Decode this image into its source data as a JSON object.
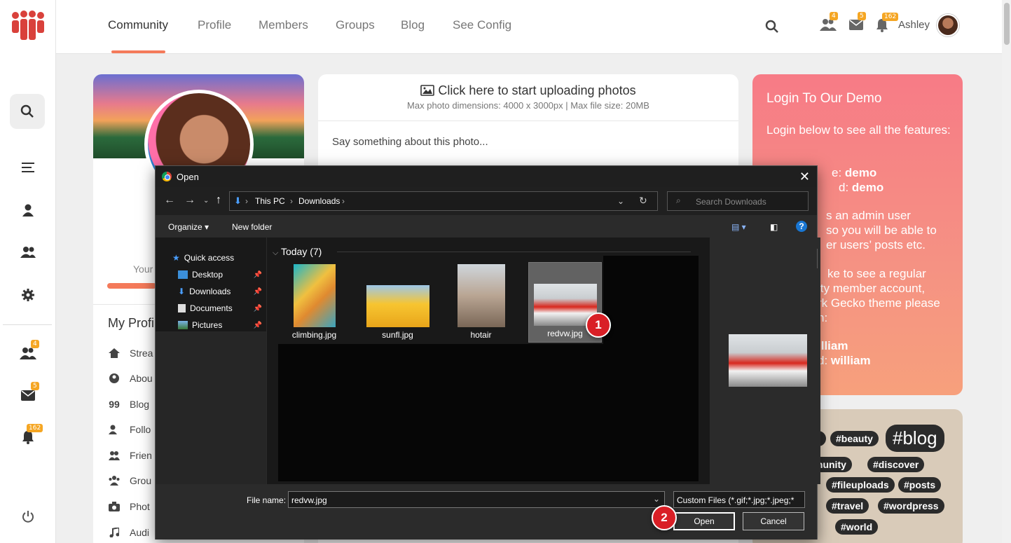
{
  "nav": {
    "items": [
      "Community",
      "Profile",
      "Members",
      "Groups",
      "Blog",
      "See Config"
    ]
  },
  "topbar": {
    "user_name": "Ashley",
    "friends_badge": "4",
    "messages_badge": "5",
    "notifications_badge": "162"
  },
  "rail": {
    "friends_badge": "4",
    "messages_badge": "5",
    "notifications_badge": "162"
  },
  "profile": {
    "your_label": "Your",
    "my_profile": "My Profi",
    "menu": [
      "Strea",
      "Abou",
      "Blog",
      "Follo",
      "Frien",
      "Grou",
      "Phot",
      "Audi"
    ]
  },
  "upload": {
    "title": "Click here to start uploading photos",
    "subtitle": "Max photo dimensions: 4000 x 3000px | Max file size: 20MB",
    "placeholder": "Say something about this photo..."
  },
  "login": {
    "title": "Login To Our Demo",
    "line1": "Login below to see all the features:",
    "username_prefix": "e:",
    "username": "demo",
    "password_prefix": "d:",
    "password": "demo",
    "admin1": "s an admin user",
    "admin2": "so you will be able to",
    "admin3": "er users’ posts etc.",
    "reg1": "ke to see a regular",
    "reg2": "ity member account,",
    "reg3": "rk Gecko theme please",
    "reg4": "n:",
    "user2": "illiam",
    "pass2_prefix": "d:",
    "pass2": "william"
  },
  "tags": [
    "g",
    "#beauty",
    "#blog",
    "munity",
    "#discover",
    "#fileuploads",
    "#posts",
    "#travel",
    "#wordpress",
    "#world"
  ],
  "dialog": {
    "title": "Open",
    "breadcrumb": [
      "This PC",
      "Downloads"
    ],
    "search_placeholder": "Search Downloads",
    "organize": "Organize",
    "new_folder": "New folder",
    "nav_items": [
      "Quick access",
      "Desktop",
      "Downloads",
      "Documents",
      "Pictures"
    ],
    "group": "Today (7)",
    "files": [
      "climbing.jpg",
      "sunfl.jpg",
      "hotair",
      "redvw.jpg"
    ],
    "file_name_label": "File name:",
    "file_name_value": "redvw.jpg",
    "file_type": "Custom Files (*.gif;*.jpg;*.jpeg;*",
    "open_button": "Open",
    "cancel_button": "Cancel"
  },
  "markers": [
    "1",
    "2"
  ],
  "colors": {
    "accent": "#f47a5a",
    "marker": "#d91f26",
    "badge": "#f5a623"
  }
}
